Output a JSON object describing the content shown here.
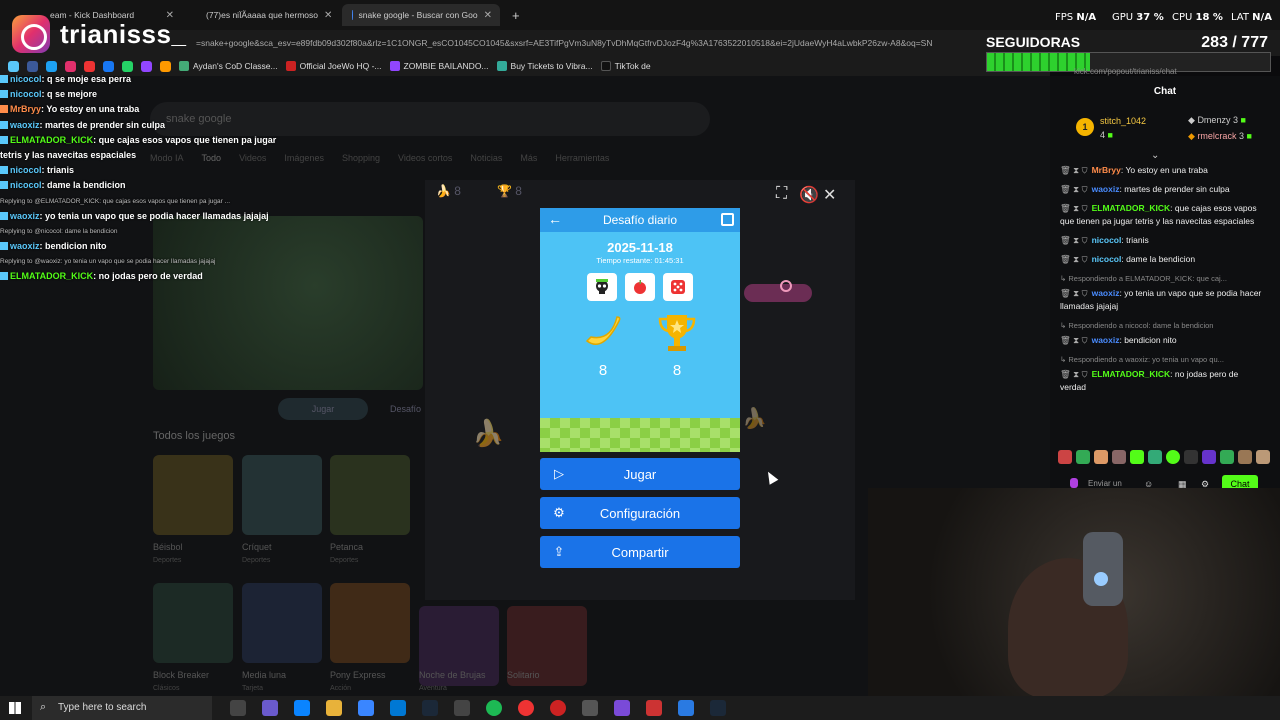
{
  "browser": {
    "tabs": [
      {
        "title": "eam - Kick Dashboard",
        "active": false
      },
      {
        "title": "(77)es niÏÃaaaa que hermoso",
        "active": false
      },
      {
        "title": "snake google - Buscar con Goo",
        "active": true
      }
    ],
    "url": "=snake+google&sca_esv=e89fdb09d302f80a&rlz=1C1ONGR_esCO1045CO1045&sxsrf=AE3TifPgVm3uN8yTvDhMqGtfrvDJozF4g%3A1763522010518&ei=2jUdaeWyH4aLwbkP26zw-A8&oq=SN",
    "bookmarks": [
      "Aydan's CoD Classe...",
      "Official JoeWo HQ -...",
      "ZOMBIE BAILANDO...",
      "Buy Tickets to Vibra...",
      "TikTok de"
    ]
  },
  "overlay": {
    "fps_label": "FPS",
    "fps_value": "N/A",
    "gpu_label": "GPU",
    "gpu_value": "37 %",
    "cpu_label": "CPU",
    "cpu_value": "18 %",
    "lat_label": "LAT",
    "lat_value": "N/A",
    "streamer": "trianisss_",
    "followers_label": "SEGUIDORAS",
    "followers_value": "283 / 777",
    "followers_progress": 0.364
  },
  "left_chat": [
    {
      "type": "msg",
      "user": "nicocol",
      "text": "q se moje esa perra"
    },
    {
      "type": "msg",
      "user": "nicocol",
      "text": "q se mejore"
    },
    {
      "type": "msg",
      "user": "MrBryy",
      "text": "Yo estoy en una traba"
    },
    {
      "type": "msg",
      "user": "waoxiz",
      "text": "martes de prender sin culpa"
    },
    {
      "type": "msg",
      "user": "ELMATADOR_KICK",
      "text": "que cajas esos vapos que tienen pa jugar"
    },
    {
      "type": "cont",
      "text": "tetris y las navecitas espaciales"
    },
    {
      "type": "msg",
      "user": "nicocol",
      "text": "trianis"
    },
    {
      "type": "msg",
      "user": "nicocol",
      "text": "dame la bendicion"
    },
    {
      "type": "rep",
      "text": "Replying to @ELMATADOR_KICK: que cajas esos vapos que tienen pa jugar ..."
    },
    {
      "type": "msg",
      "user": "waoxiz",
      "text": "yo tenia un vapo que se podia hacer llamadas jajajaj"
    },
    {
      "type": "rep",
      "text": "Replying to @nicocol: dame la bendicion"
    },
    {
      "type": "msg",
      "user": "waoxiz",
      "text": "bendicion nito"
    },
    {
      "type": "rep",
      "text": "Replying to @waoxiz: yo tenia un vapo que se podia hacer llamadas jajajaj"
    },
    {
      "type": "msg",
      "user": "ELMATADOR_KICK",
      "text": "no jodas pero de verdad"
    }
  ],
  "google": {
    "search_text": "snake google",
    "tabs": [
      "Modo IA",
      "Todo",
      "Videos",
      "Imágenes",
      "Shopping",
      "Videos cortos",
      "Noticias",
      "Más",
      "Herramientas"
    ],
    "play_label": "Jugar",
    "settings_label": "Desafío",
    "section_title": "Todos los juegos",
    "games": [
      {
        "name": "Béisbol",
        "cat": "Deportes"
      },
      {
        "name": "Críquet",
        "cat": "Deportes"
      },
      {
        "name": "Petanca",
        "cat": "Deportes"
      },
      {
        "name": "Block Breaker",
        "cat": "Clásicos"
      },
      {
        "name": "Media luna",
        "cat": "Tarjeta"
      },
      {
        "name": "Pony Express",
        "cat": "Acción"
      },
      {
        "name": "Noche de Brujas",
        "cat": "Aventura"
      },
      {
        "name": "Solitario",
        "cat": "Tarjeta"
      }
    ]
  },
  "game": {
    "top_fruits": "8",
    "top_trophy": "8",
    "panel_title": "Desafío diario",
    "date": "2025-11-18",
    "time_remaining": "Tiempo restante: 01:45:31",
    "score_fruit": "8",
    "score_trophy": "8",
    "play_button": "Jugar",
    "config_button": "Configuración",
    "share_button": "Compartir"
  },
  "kick_chat": {
    "url": "kick.com/popout/trianiss/chat",
    "title": "Chat",
    "pinned": [
      {
        "user": "stitch_1042",
        "count": "4"
      },
      {
        "user": "Dmenzy",
        "count": "3"
      },
      {
        "user": "rmelcrack",
        "count": "3"
      }
    ],
    "top_rank": "1",
    "messages": [
      {
        "type": "msg",
        "user": "MrBryy",
        "text": "Yo estoy en una traba"
      },
      {
        "type": "msg",
        "user": "waoxiz",
        "text": "martes de prender sin culpa"
      },
      {
        "type": "msg",
        "user": "ELMATADOR_KICK",
        "text": "que cajas esos vapos que tienen pa jugar tetris y las navecitas espaciales"
      },
      {
        "type": "msg",
        "user": "nicocol",
        "text": "trianis"
      },
      {
        "type": "msg",
        "user": "nicocol",
        "text": "dame la bendicion"
      },
      {
        "type": "rep",
        "text": "Respondiendo a ELMATADOR_KICK: que caj..."
      },
      {
        "type": "msg",
        "user": "waoxiz",
        "text": "yo tenia un vapo que se podia hacer llamadas jajajaj"
      },
      {
        "type": "rep",
        "text": "Respondiendo a nicocol: dame la bendicion"
      },
      {
        "type": "msg",
        "user": "waoxiz",
        "text": "bendicion nito"
      },
      {
        "type": "rep",
        "text": "Respondiendo a waoxiz: yo tenia un vapo qu..."
      },
      {
        "type": "msg",
        "user": "ELMATADOR_KICK",
        "text": "no jodas pero de verdad"
      }
    ],
    "send_placeholder": "Enviar un",
    "chat_button": "Chat"
  },
  "taskbar": {
    "search_placeholder": "Type here to search"
  },
  "colors": {
    "game_blue": "#1a73e8",
    "panel_sky": "#4dc3f5",
    "kick_green": "#53fc18",
    "user_cyan": "#5ac8fa",
    "user_blue": "#4a8cff",
    "user_green": "#53fc18"
  }
}
